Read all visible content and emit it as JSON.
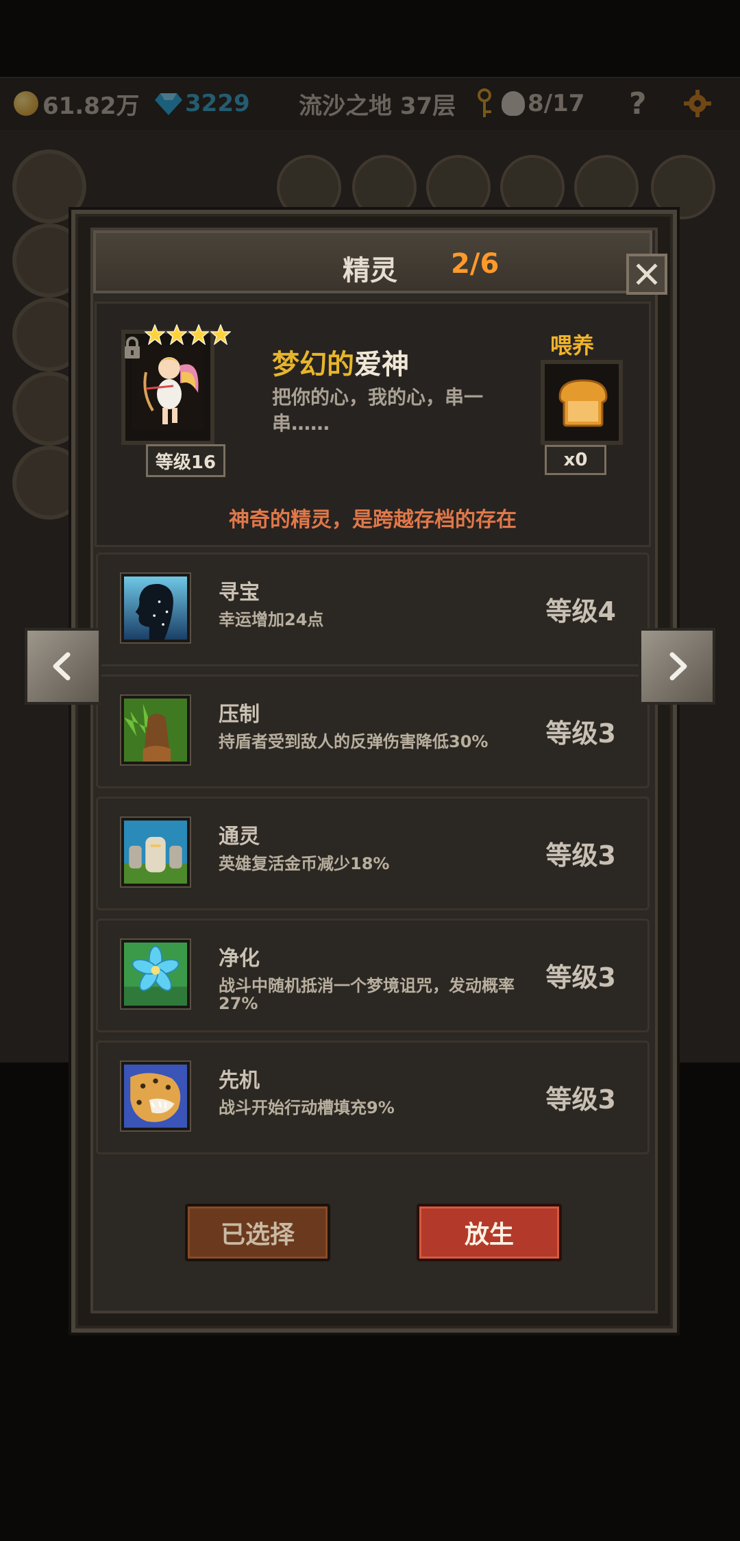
{
  "status_bar": {
    "gold": "61.82万",
    "gems": "3229",
    "location": "流沙之地 37层",
    "skull_progress": "8/17",
    "help_glyph": "?"
  },
  "modal": {
    "title": "精灵",
    "count": "2/6",
    "close_glyph": "×"
  },
  "spirit": {
    "stars": 4,
    "name_part1": "梦幻的",
    "name_part2": "爱神",
    "description": "把你的心，我的心，串一串……",
    "level": "等级16",
    "feed_label": "喂养",
    "feed_qty": "x0",
    "tagline": "神奇的精灵，是跨越存档的存在"
  },
  "skills": [
    {
      "name": "寻宝",
      "desc": "幸运增加24点",
      "level": "等级4"
    },
    {
      "name": "压制",
      "desc": "持盾者受到敌人的反弹伤害降低30%",
      "level": "等级3"
    },
    {
      "name": "通灵",
      "desc": "英雄复活金币减少18%",
      "level": "等级3"
    },
    {
      "name": "净化",
      "desc": "战斗中随机抵消一个梦境诅咒，发动概率27%",
      "level": "等级3"
    },
    {
      "name": "先机",
      "desc": "战斗开始行动槽填充9%",
      "level": "等级3"
    }
  ],
  "buttons": {
    "selected": "已选择",
    "release": "放生"
  },
  "colors": {
    "accent_orange": "#ff9a2a",
    "gold_text": "#e7b52b",
    "tagline": "#e0784a",
    "release_button": "#b33a2a"
  }
}
